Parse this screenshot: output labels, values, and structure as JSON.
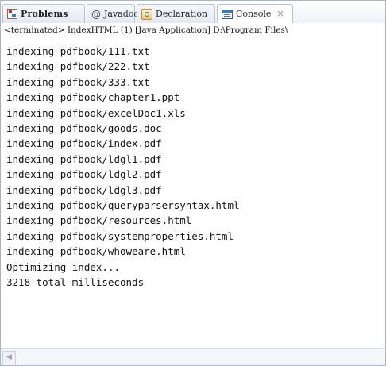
{
  "tabs": [
    {
      "label": "Problems",
      "icon": "problems-icon",
      "active": false
    },
    {
      "label": "Javadoc",
      "icon": "at-sign-icon",
      "glyph": "@",
      "active": false
    },
    {
      "label": "Declaration",
      "icon": "declaration-icon",
      "active": false
    },
    {
      "label": "Console",
      "icon": "console-icon",
      "active": true,
      "close_glyph": "✕"
    }
  ],
  "status": "<terminated> IndexHTML (1) [Java Application] D:\\Program Files\\",
  "console_lines": [
    "indexing pdfbook/111.txt",
    "indexing pdfbook/222.txt",
    "indexing pdfbook/333.txt",
    "indexing pdfbook/chapter1.ppt",
    "indexing pdfbook/excelDoc1.xls",
    "indexing pdfbook/goods.doc",
    "indexing pdfbook/index.pdf",
    "indexing pdfbook/ldgl1.pdf",
    "indexing pdfbook/ldgl2.pdf",
    "indexing pdfbook/ldgl3.pdf",
    "indexing pdfbook/queryparsersyntax.html",
    "indexing pdfbook/resources.html",
    "indexing pdfbook/systemproperties.html",
    "indexing pdfbook/whoweare.html",
    "Optimizing index...",
    "3218 total milliseconds"
  ],
  "scrollbar": {
    "left_arrow_glyph": "◀"
  },
  "colors": {
    "tab_border": "#b4c3d6",
    "accent": "#3b78c8",
    "background": "#ffffff"
  }
}
